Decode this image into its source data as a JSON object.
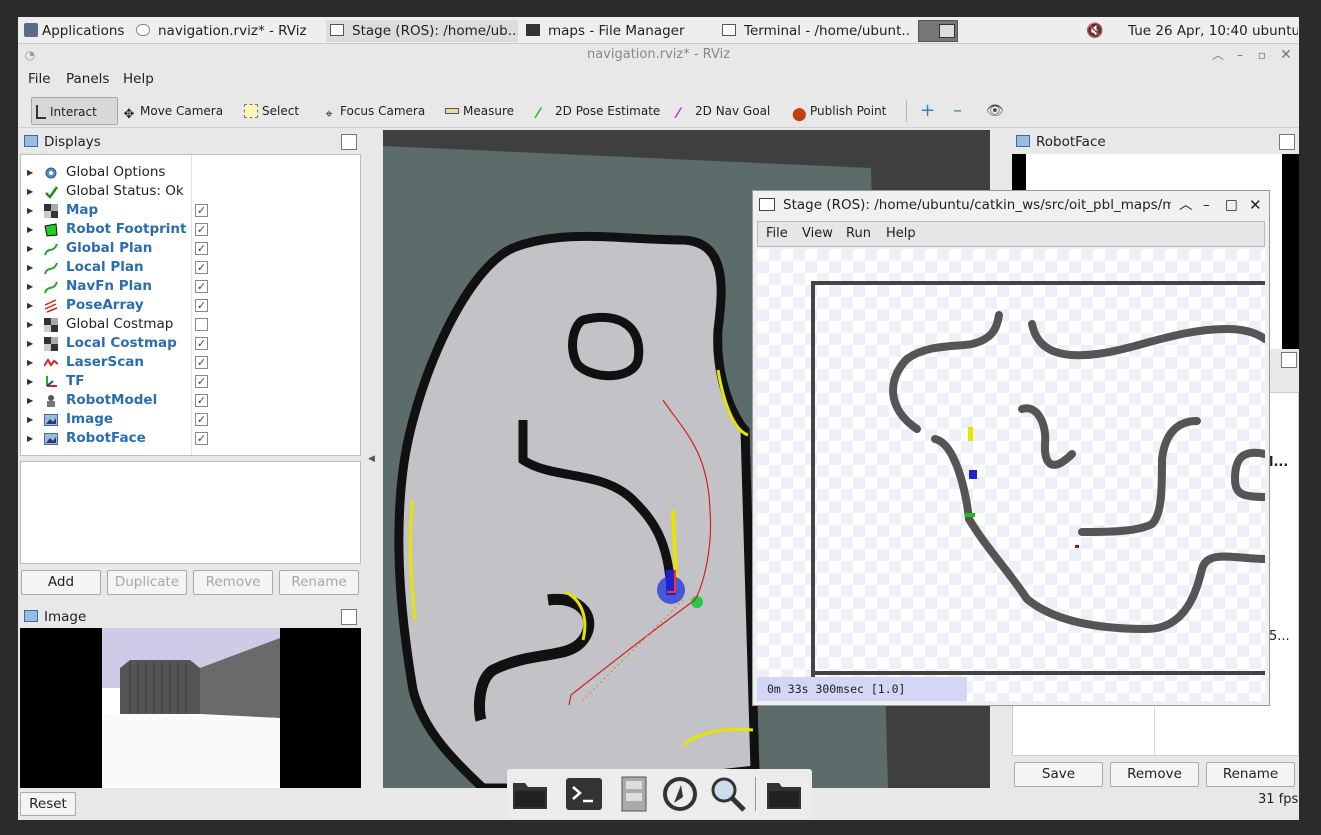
{
  "taskbar": {
    "apps_label": "Applications",
    "items": [
      {
        "label": "navigation.rviz* - RViz"
      },
      {
        "label": "Stage (ROS): /home/ub..."
      },
      {
        "label": "maps - File Manager"
      },
      {
        "label": "Terminal - /home/ubunt..."
      }
    ],
    "datetime": "Tue 26 Apr, 10:40",
    "user": "ubuntu"
  },
  "rviz": {
    "title": "navigation.rviz* - RViz",
    "menu": [
      "File",
      "Panels",
      "Help"
    ],
    "tools": [
      {
        "label": "Interact",
        "icon": "cursor-icon",
        "active": true
      },
      {
        "label": "Move Camera",
        "icon": "move-camera-icon"
      },
      {
        "label": "Select",
        "icon": "select-icon"
      },
      {
        "label": "Focus Camera",
        "icon": "focus-camera-icon"
      },
      {
        "label": "Measure",
        "icon": "ruler-icon"
      },
      {
        "label": "2D Pose Estimate",
        "icon": "pose-estimate-icon",
        "color": "#22aa22"
      },
      {
        "label": "2D Nav Goal",
        "icon": "nav-goal-icon",
        "color": "#d020c0"
      },
      {
        "label": "Publish Point",
        "icon": "map-pin-icon",
        "color": "#c04010"
      }
    ],
    "displays_panel": {
      "title": "Displays",
      "items": [
        {
          "label": "Global Options",
          "icon": "gear-icon",
          "checkbox": null,
          "highlight": false
        },
        {
          "label": "Global Status: Ok",
          "icon": "check-icon",
          "checkbox": null,
          "highlight": false
        },
        {
          "label": "Map",
          "icon": "map-grid-icon",
          "checkbox": true,
          "highlight": true
        },
        {
          "label": "Robot Footprint",
          "icon": "polygon-icon",
          "checkbox": true,
          "highlight": true
        },
        {
          "label": "Global Plan",
          "icon": "path-icon",
          "checkbox": true,
          "highlight": true
        },
        {
          "label": "Local Plan",
          "icon": "path-icon",
          "checkbox": true,
          "highlight": true
        },
        {
          "label": "NavFn Plan",
          "icon": "path-icon",
          "checkbox": true,
          "highlight": true
        },
        {
          "label": "PoseArray",
          "icon": "pose-array-icon",
          "checkbox": true,
          "highlight": true
        },
        {
          "label": "Global Costmap",
          "icon": "map-grid-icon",
          "checkbox": false,
          "highlight": false
        },
        {
          "label": "Local Costmap",
          "icon": "map-grid-icon",
          "checkbox": true,
          "highlight": true
        },
        {
          "label": "LaserScan",
          "icon": "laser-icon",
          "checkbox": true,
          "highlight": true
        },
        {
          "label": "TF",
          "icon": "axes-icon",
          "checkbox": true,
          "highlight": true
        },
        {
          "label": "RobotModel",
          "icon": "robot-icon",
          "checkbox": true,
          "highlight": true
        },
        {
          "label": "Image",
          "icon": "image-icon",
          "checkbox": true,
          "highlight": true
        },
        {
          "label": "RobotFace",
          "icon": "image-icon",
          "checkbox": true,
          "highlight": true
        }
      ],
      "buttons": {
        "add": "Add",
        "duplicate": "Duplicate",
        "remove": "Remove",
        "rename": "Rename"
      }
    },
    "image_panel": {
      "title": "Image"
    },
    "reset_label": "Reset",
    "robotface_panel": {
      "title": "RobotFace",
      "partial_text_1": "l...",
      "partial_text_2": "5..."
    },
    "right_buttons": {
      "save": "Save",
      "remove": "Remove",
      "rename": "Rename"
    },
    "fps": "31 fps"
  },
  "stage": {
    "title": "Stage (ROS): /home/ubuntu/catkin_ws/src/oit_pbl_maps/m",
    "menu": [
      "File",
      "View",
      "Run",
      "Help"
    ],
    "status": "0m 33s 300msec [1.0]"
  },
  "dock": {
    "icons": [
      "folder-icon",
      "terminal-icon",
      "file-cabinet-icon",
      "app-finder-icon",
      "search-icon",
      "folder-icon"
    ]
  }
}
